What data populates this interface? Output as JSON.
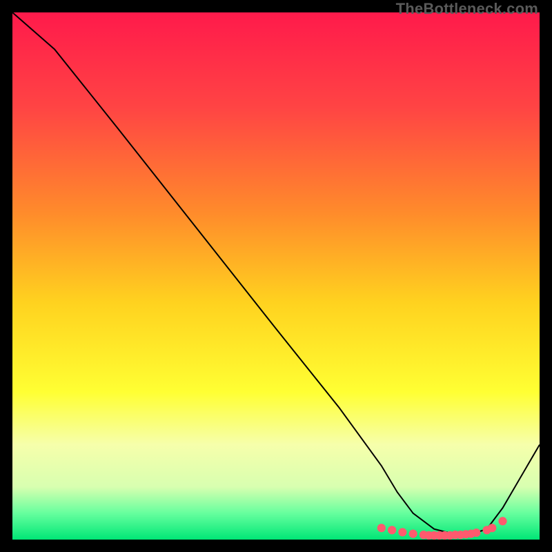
{
  "watermark": "TheBottleneck.com",
  "chart_data": {
    "type": "line",
    "xlim": [
      0,
      100
    ],
    "ylim": [
      0,
      100
    ],
    "xlabel": "",
    "ylabel": "",
    "title": "",
    "grid": false,
    "legend": false,
    "gradient_stops": [
      {
        "pct": 0,
        "color": "#ff1a4b"
      },
      {
        "pct": 18,
        "color": "#ff4444"
      },
      {
        "pct": 38,
        "color": "#ff8b2b"
      },
      {
        "pct": 55,
        "color": "#ffd21f"
      },
      {
        "pct": 72,
        "color": "#ffff33"
      },
      {
        "pct": 82,
        "color": "#f6ffab"
      },
      {
        "pct": 90,
        "color": "#d8ffb0"
      },
      {
        "pct": 95,
        "color": "#66ff9e"
      },
      {
        "pct": 100,
        "color": "#00e676"
      }
    ],
    "series": [
      {
        "name": "curve",
        "type": "line",
        "color": "#000000",
        "x": [
          0,
          8,
          20,
          35,
          50,
          62,
          70,
          73,
          76,
          80,
          84,
          87,
          90,
          93,
          100
        ],
        "y": [
          100,
          93,
          78,
          59,
          40,
          25,
          14,
          9,
          5,
          2,
          1,
          1,
          2,
          6,
          18
        ]
      },
      {
        "name": "bottom-markers",
        "type": "scatter",
        "color": "#ff5a6e",
        "x": [
          70,
          72,
          74,
          76,
          78,
          79,
          80,
          81,
          82,
          83,
          84,
          85,
          86,
          87,
          88,
          90,
          91,
          93
        ],
        "y": [
          2.2,
          1.8,
          1.4,
          1.1,
          0.9,
          0.8,
          0.8,
          0.8,
          0.8,
          0.8,
          0.9,
          0.9,
          1.0,
          1.1,
          1.3,
          1.8,
          2.2,
          3.5
        ]
      }
    ]
  }
}
